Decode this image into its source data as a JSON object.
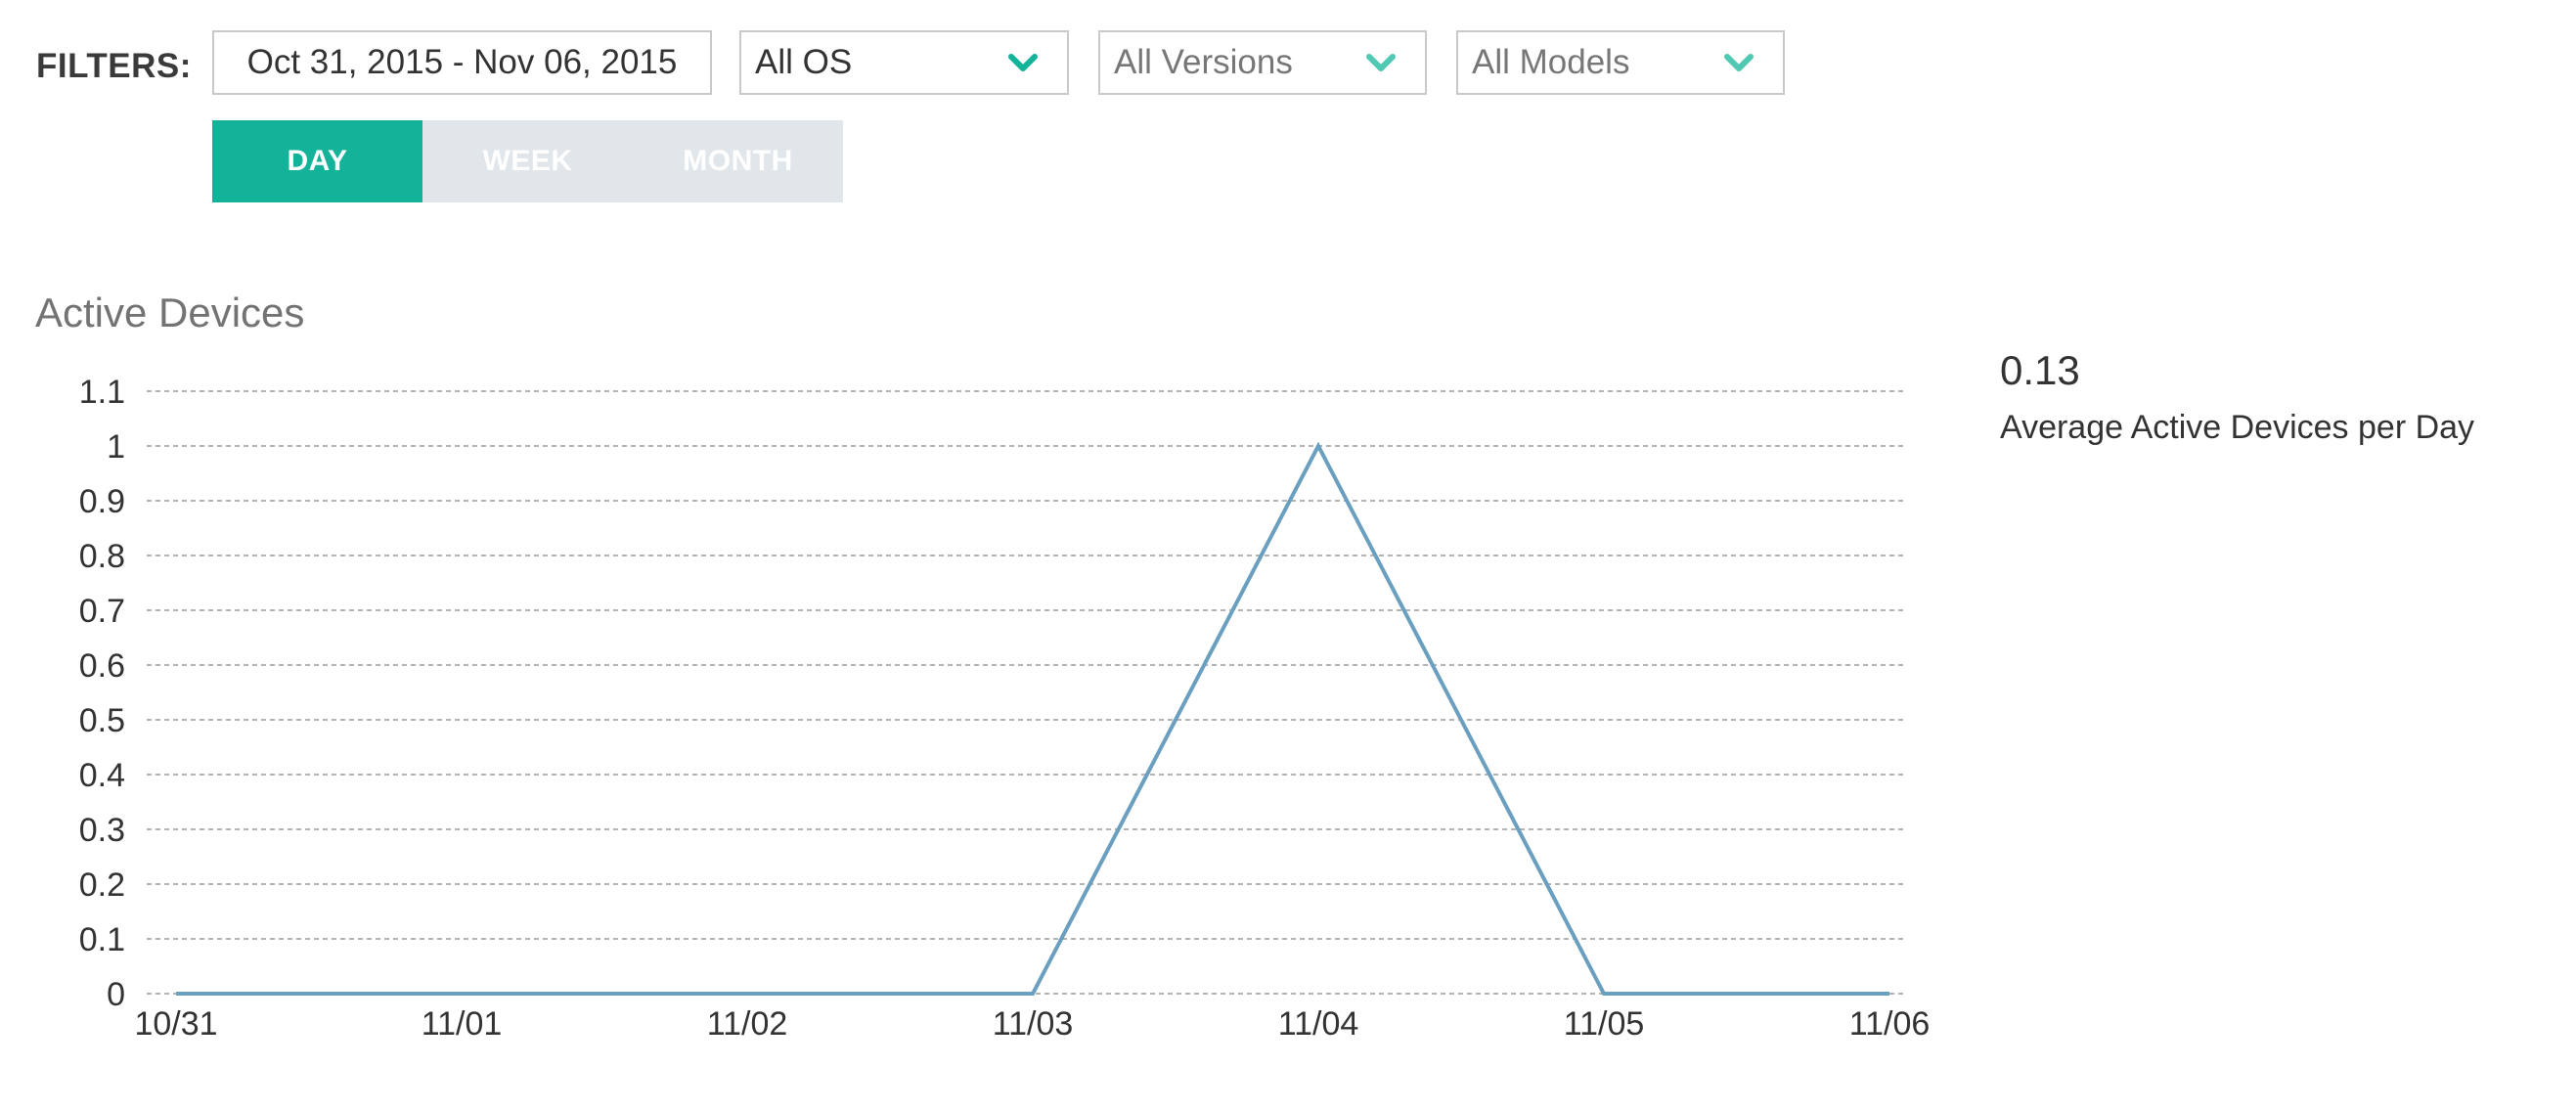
{
  "filters": {
    "label": "FILTERS:",
    "date_range": "Oct 31, 2015 - Nov 06, 2015",
    "os": {
      "selected": "All OS"
    },
    "versions": {
      "selected": "All Versions"
    },
    "models": {
      "selected": "All Models"
    }
  },
  "period": {
    "options": [
      "DAY",
      "WEEK",
      "MONTH"
    ],
    "active": "DAY"
  },
  "colors": {
    "accent": "#13b39a",
    "chevron_light": "#4fc9b3",
    "line": "#6a9fc0",
    "grid": "#9a9a9a"
  },
  "chart_data": {
    "type": "line",
    "title": "Active Devices",
    "categories": [
      "10/31",
      "11/01",
      "11/02",
      "11/03",
      "11/04",
      "11/05",
      "11/06"
    ],
    "series": [
      {
        "values": [
          0,
          0,
          0,
          0,
          1,
          0,
          0
        ]
      }
    ],
    "yticks": [
      "0",
      "0.1",
      "0.2",
      "0.3",
      "0.4",
      "0.5",
      "0.6",
      "0.7",
      "0.8",
      "0.9",
      "1",
      "1.1"
    ],
    "ylim": [
      0,
      1.1
    ],
    "grid": true,
    "xlabel": "",
    "ylabel": ""
  },
  "summary": {
    "value": "0.13",
    "label": "Average Active Devices per Day"
  }
}
